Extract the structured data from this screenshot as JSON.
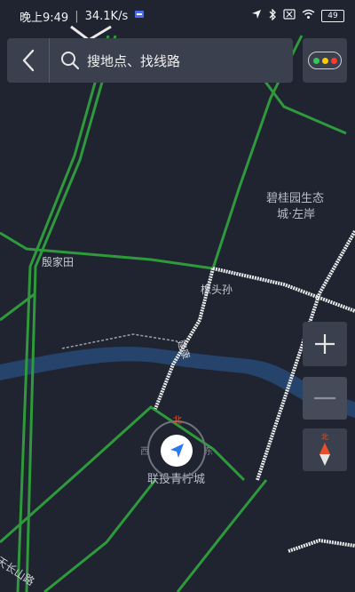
{
  "status_bar": {
    "time": "晚上9:49",
    "separator": "|",
    "network_speed": "34.1K/s",
    "battery": "49"
  },
  "search": {
    "placeholder": "搜地点、找线路"
  },
  "map": {
    "labels": {
      "yinjiatian": "殷家田",
      "bi_gui_yuan_line1": "碧桂园生态",
      "bi_gui_yuan_line2": "城·左岸",
      "toutousun": "橡头孙",
      "jian_kang": "建康",
      "lian_tou": "联投青柠城",
      "tian_chang_shan_road": "天长山路"
    },
    "compass": {
      "north": "北",
      "west": "西",
      "east": "东"
    }
  },
  "controls": {
    "zoom_in": "+",
    "zoom_out": "—",
    "compass_north": "北"
  },
  "colors": {
    "background": "#1f2430",
    "road_green": "#2f9a3c",
    "road_white": "#e9e9e9",
    "river": "#26436b",
    "panel": "#3a404d",
    "traffic_green": "#34c759",
    "traffic_yellow": "#ffcc00",
    "traffic_red": "#ff3b30",
    "locator_blue": "#2a78f0"
  }
}
